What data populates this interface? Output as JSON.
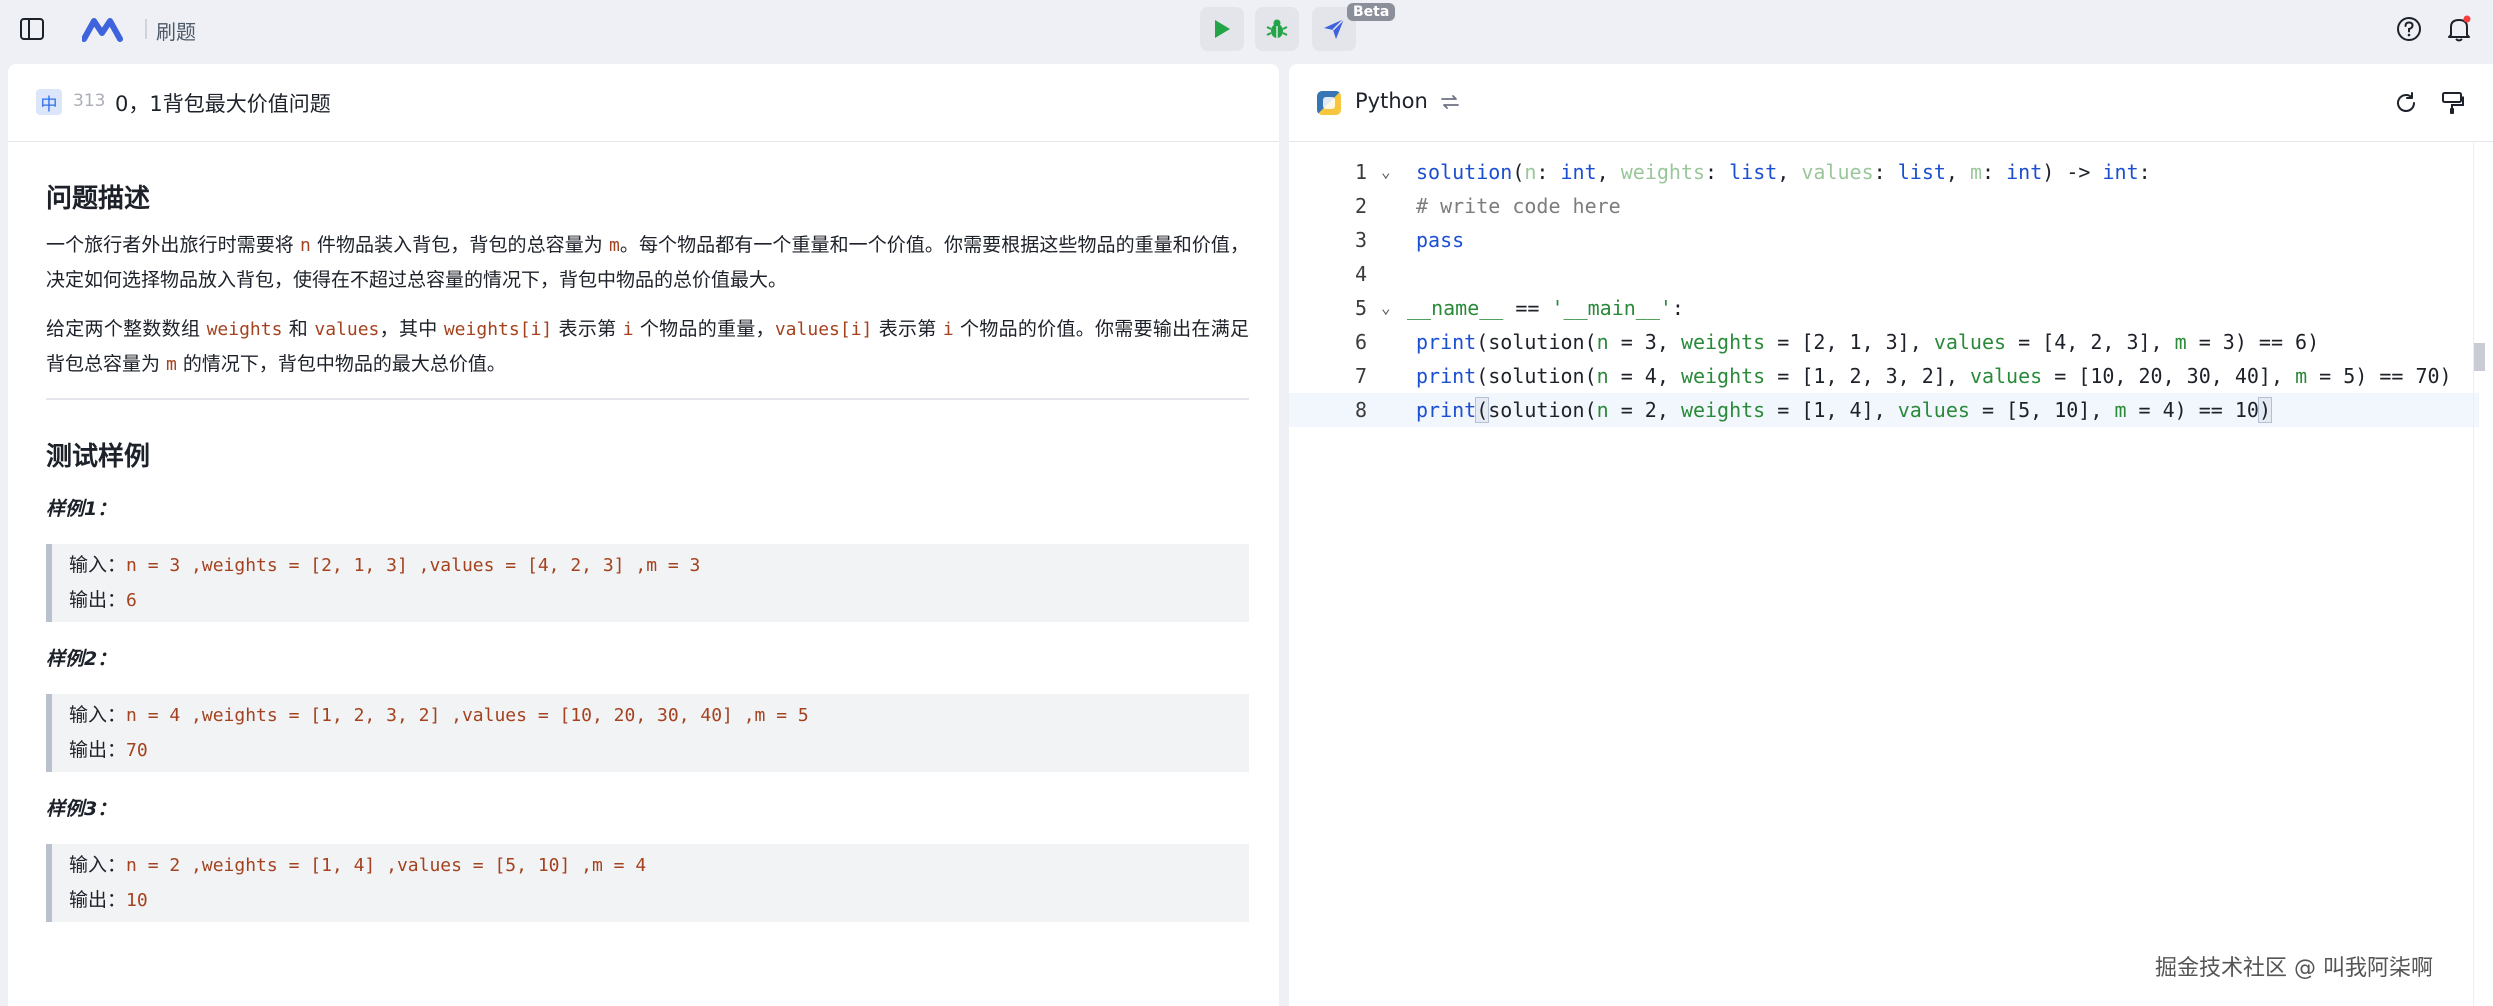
{
  "topbar": {
    "title": "刷题",
    "beta": "Beta"
  },
  "problem": {
    "difficulty": "中",
    "id": "313",
    "title": "0，1背包最大价值问题",
    "section_description": "问题描述",
    "desc1_a": "一个旅行者外出旅行时需要将 ",
    "desc1_n": "n",
    "desc1_b": " 件物品装入背包，背包的总容量为 ",
    "desc1_m": "m",
    "desc1_c": "。每个物品都有一个重量和一个价值。你需要根据这些物品的重量和价值，决定如何选择物品放入背包，使得在不超过总容量的情况下，背包中物品的总价值最大。",
    "desc2_a": "给定两个整数数组 ",
    "desc2_weights": "weights",
    "desc2_b": " 和 ",
    "desc2_values": "values",
    "desc2_c": "，其中 ",
    "desc2_wi": "weights[i]",
    "desc2_d": " 表示第 ",
    "desc2_i1": "i",
    "desc2_e": " 个物品的重量，",
    "desc2_vi": "values[i]",
    "desc2_f": " 表示第 ",
    "desc2_i2": "i",
    "desc2_g": " 个物品的价值。你需要输出在满足背包总容量为 ",
    "desc2_m": "m",
    "desc2_h": " 的情况下，背包中物品的最大总价值。",
    "section_tests": "测试样例",
    "examples": [
      {
        "label": "样例1：",
        "input_label": "输入：",
        "input": "n = 3 ,weights = [2, 1, 3] ,values = [4, 2, 3] ,m = 3",
        "output_label": "输出：",
        "output": "6"
      },
      {
        "label": "样例2：",
        "input_label": "输入：",
        "input": "n = 4 ,weights = [1, 2, 3, 2] ,values = [10, 20, 30, 40] ,m = 5",
        "output_label": "输出：",
        "output": "70"
      },
      {
        "label": "样例3：",
        "input_label": "输入：",
        "input": "n = 2 ,weights = [1, 4] ,values = [5, 10] ,m = 4",
        "output_label": "输出：",
        "output": "10"
      }
    ]
  },
  "editor": {
    "language": "Python",
    "line_numbers": [
      "1",
      "2",
      "3",
      "4",
      "5",
      "6",
      "7",
      "8"
    ],
    "active_line": 8
  },
  "watermark": "掘金技术社区 @ 叫我阿柒啊"
}
